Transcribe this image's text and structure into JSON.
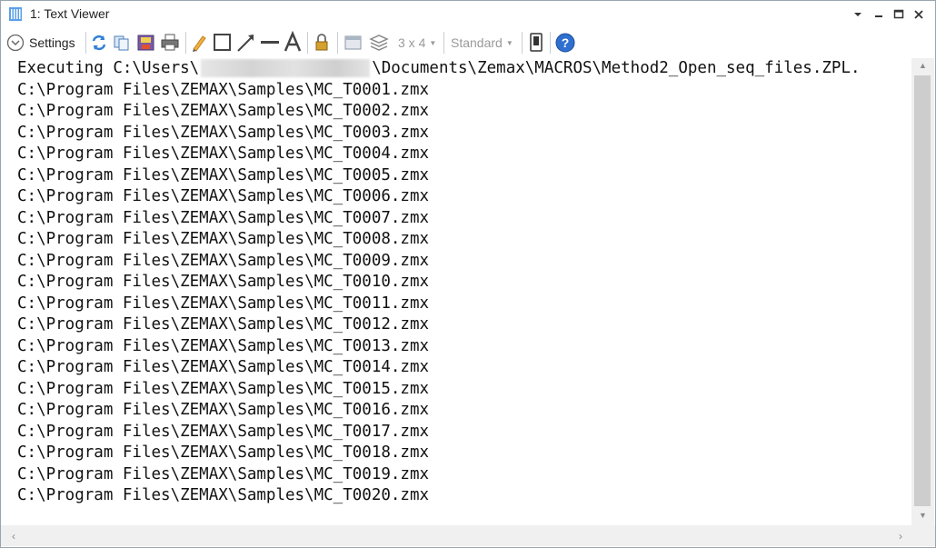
{
  "window": {
    "title": "1: Text Viewer"
  },
  "toolbar": {
    "settings_label": "Settings",
    "grid_label": "3 x 4",
    "style_label": "Standard",
    "icons": [
      "refresh-icon",
      "copy-icon",
      "save-image-icon",
      "print-icon",
      "pencil-icon",
      "rectangle-icon",
      "arrow-line-icon",
      "line-icon",
      "text-icon",
      "lock-icon",
      "window-icon",
      "layers-icon",
      "page-icon",
      "help-icon"
    ]
  },
  "content": {
    "executing_prefix": "Executing C:\\Users\\",
    "executing_suffix": "\\Documents\\Zemax\\MACROS\\Method2_Open_seq_files.ZPL.",
    "lines": [
      "C:\\Program Files\\ZEMAX\\Samples\\MC_T0001.zmx",
      "C:\\Program Files\\ZEMAX\\Samples\\MC_T0002.zmx",
      "C:\\Program Files\\ZEMAX\\Samples\\MC_T0003.zmx",
      "C:\\Program Files\\ZEMAX\\Samples\\MC_T0004.zmx",
      "C:\\Program Files\\ZEMAX\\Samples\\MC_T0005.zmx",
      "C:\\Program Files\\ZEMAX\\Samples\\MC_T0006.zmx",
      "C:\\Program Files\\ZEMAX\\Samples\\MC_T0007.zmx",
      "C:\\Program Files\\ZEMAX\\Samples\\MC_T0008.zmx",
      "C:\\Program Files\\ZEMAX\\Samples\\MC_T0009.zmx",
      "C:\\Program Files\\ZEMAX\\Samples\\MC_T0010.zmx",
      "C:\\Program Files\\ZEMAX\\Samples\\MC_T0011.zmx",
      "C:\\Program Files\\ZEMAX\\Samples\\MC_T0012.zmx",
      "C:\\Program Files\\ZEMAX\\Samples\\MC_T0013.zmx",
      "C:\\Program Files\\ZEMAX\\Samples\\MC_T0014.zmx",
      "C:\\Program Files\\ZEMAX\\Samples\\MC_T0015.zmx",
      "C:\\Program Files\\ZEMAX\\Samples\\MC_T0016.zmx",
      "C:\\Program Files\\ZEMAX\\Samples\\MC_T0017.zmx",
      "C:\\Program Files\\ZEMAX\\Samples\\MC_T0018.zmx",
      "C:\\Program Files\\ZEMAX\\Samples\\MC_T0019.zmx",
      "C:\\Program Files\\ZEMAX\\Samples\\MC_T0020.zmx"
    ]
  },
  "colors": {
    "accent_blue": "#3b7fd4",
    "help_blue": "#2f6fd0"
  }
}
